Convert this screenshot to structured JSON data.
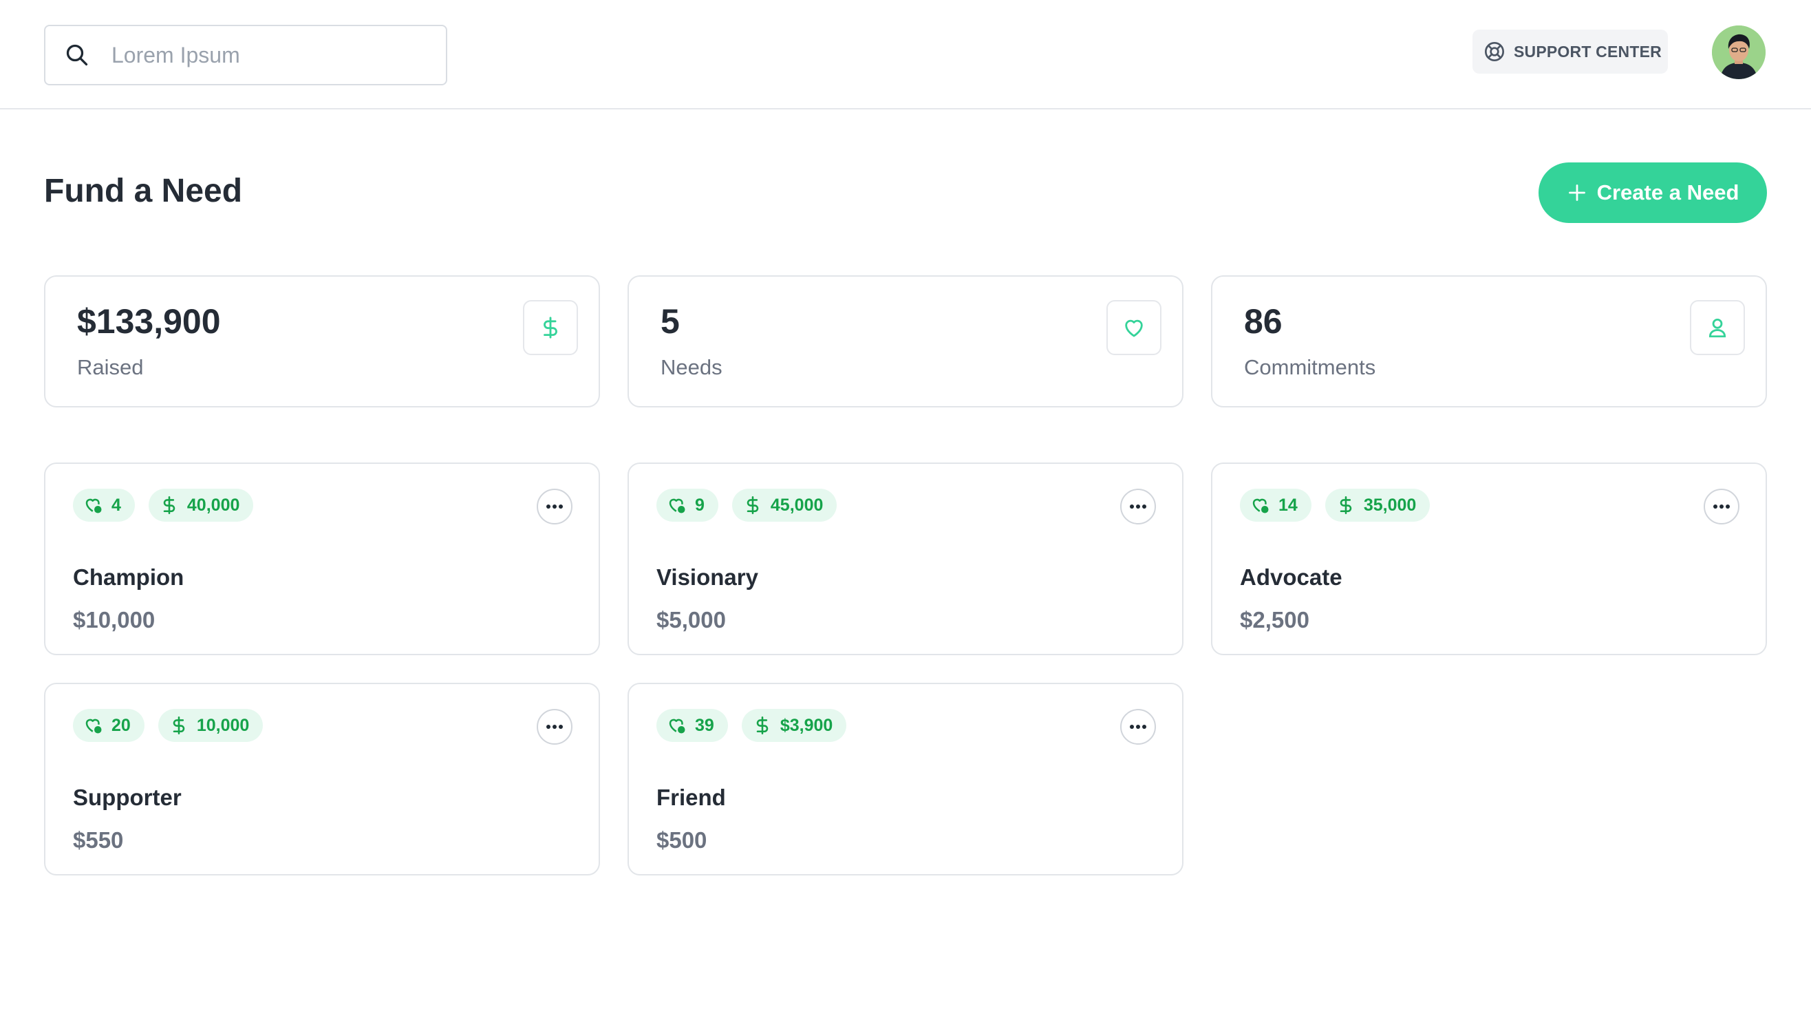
{
  "search": {
    "placeholder": "Lorem Ipsum",
    "value": ""
  },
  "header": {
    "support_label": "SUPPORT CENTER"
  },
  "page": {
    "title": "Fund a Need",
    "create_label": "Create a Need"
  },
  "stats": [
    {
      "value": "$133,900",
      "label": "Raised",
      "icon": "dollar-icon"
    },
    {
      "value": "5",
      "label": "Needs",
      "icon": "heart-icon"
    },
    {
      "value": "86",
      "label": "Commitments",
      "icon": "user-icon"
    }
  ],
  "needs": [
    {
      "name": "Champion",
      "amount": "$10,000",
      "commitments": "4",
      "funded": "40,000"
    },
    {
      "name": "Visionary",
      "amount": "$5,000",
      "commitments": "9",
      "funded": "45,000"
    },
    {
      "name": "Advocate",
      "amount": "$2,500",
      "commitments": "14",
      "funded": "35,000"
    },
    {
      "name": "Supporter",
      "amount": "$550",
      "commitments": "20",
      "funded": "10,000"
    },
    {
      "name": "Friend",
      "amount": "$500",
      "commitments": "39",
      "funded": "$3,900"
    }
  ],
  "colors": {
    "accent": "#34d399",
    "chip_bg": "#e6f8ef",
    "chip_text": "#16a34a"
  }
}
